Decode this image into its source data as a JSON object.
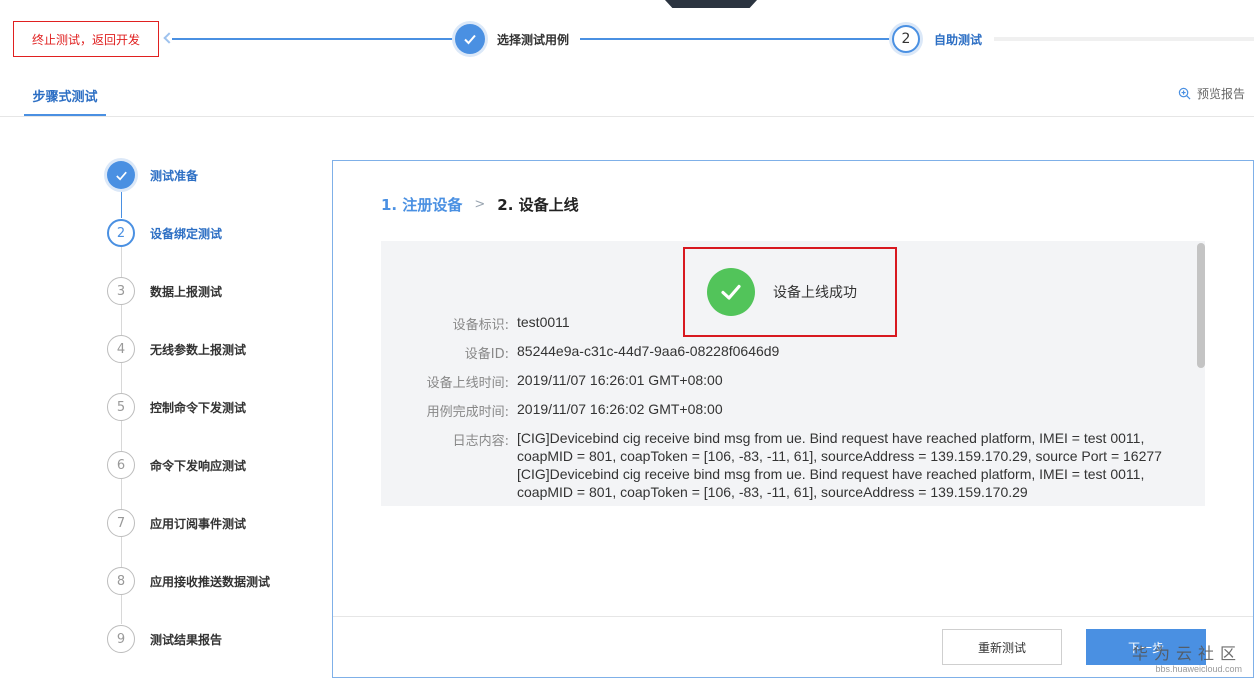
{
  "topbar": {
    "abort_label": "终止测试，返回开发",
    "step1_label": "选择测试用例",
    "step2_number": "2",
    "step2_label": "自助测试"
  },
  "tabs": {
    "active_label": "步骤式测试",
    "preview_label": "预览报告"
  },
  "steps": [
    {
      "number": "",
      "label": "测试准备",
      "state": "done"
    },
    {
      "number": "2",
      "label": "设备绑定测试",
      "state": "current"
    },
    {
      "number": "3",
      "label": "数据上报测试",
      "state": "todo"
    },
    {
      "number": "4",
      "label": "无线参数上报测试",
      "state": "todo"
    },
    {
      "number": "5",
      "label": "控制命令下发测试",
      "state": "todo"
    },
    {
      "number": "6",
      "label": "命令下发响应测试",
      "state": "todo"
    },
    {
      "number": "7",
      "label": "应用订阅事件测试",
      "state": "todo"
    },
    {
      "number": "8",
      "label": "应用接收推送数据测试",
      "state": "todo"
    },
    {
      "number": "9",
      "label": "测试结果报告",
      "state": "todo"
    }
  ],
  "breadcrumb": {
    "item1": "1. 注册设备",
    "separator": ">",
    "item2": "2. 设备上线"
  },
  "result": {
    "message": "设备上线成功",
    "fields": {
      "device_tag_label": "设备标识:",
      "device_tag_value": "test0011",
      "device_id_label": "设备ID:",
      "device_id_value": "85244e9a-c31c-44d7-9aa6-08228f0646d9",
      "online_time_label": "设备上线时间:",
      "online_time_value": "2019/11/07 16:26:01 GMT+08:00",
      "done_time_label": "用例完成时间:",
      "done_time_value": "2019/11/07 16:26:02 GMT+08:00",
      "log_label": "日志内容:",
      "log_line1": "[CIG]Devicebind cig receive bind msg from ue. Bind request have reached platform, IMEI = test 0011, coapMID = 801, coapToken = [106, -83, -11, 61], sourceAddress = 139.159.170.29, source Port = 16277",
      "log_line2": "[CIG]Devicebind cig receive bind msg from ue. Bind request have reached platform, IMEI = test 0011, coapMID = 801, coapToken = [106, -83, -11, 61], sourceAddress = 139.159.170.29"
    }
  },
  "footer": {
    "retest_label": "重新测试",
    "next_label": "下一步"
  },
  "watermark": {
    "line1": "华为云社区",
    "line2": "bbs.huaweicloud.com"
  },
  "colors": {
    "accent": "#4a90e2",
    "danger": "#e02020",
    "success": "#52c45a"
  }
}
